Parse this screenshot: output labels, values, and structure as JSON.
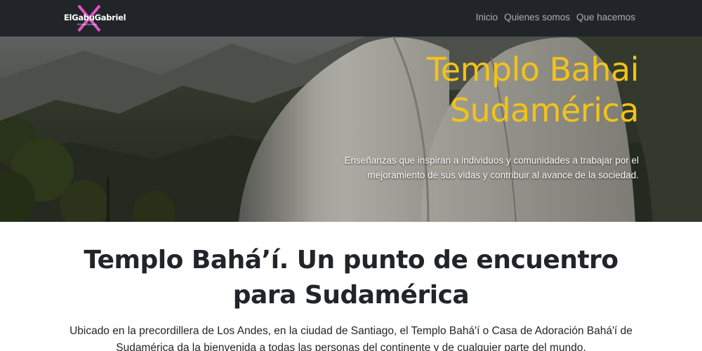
{
  "navbar": {
    "brand": {
      "name": "ElGabuGabriel",
      "subtitle": "ElGabuDevelop"
    },
    "links": [
      "Inicio",
      "Quienes somos",
      "Que hacemos"
    ]
  },
  "hero": {
    "title_lines": [
      "Templo Bahai",
      "Sudamérica"
    ],
    "text": "Enseñanzas que inspiran a individuos y comunidades a trabajar por el mejoramiento de sus vidas y contribuir al avance de la sociedad.",
    "image": "templo-bahai-photo"
  },
  "main": {
    "title_lines": [
      "Templo Bahá’í. Un punto de encuentro",
      "para Sudamérica"
    ],
    "text": "Ubicado en la precordillera de Los Andes, en la ciudad de Santiago, el Templo Bahá'í o Casa de Adoración Bahá'í de Sudamérica da la bienvenida a todas las personas del continente y de cualquier parte del mundo."
  },
  "colors": {
    "navbar_bg": "#212529",
    "accent_yellow": "#f3c316",
    "brand_x": "#e255c8"
  }
}
